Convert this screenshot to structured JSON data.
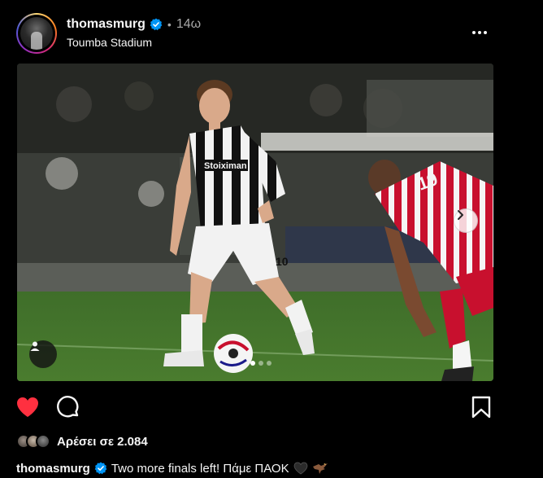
{
  "header": {
    "username": "thomasmurg",
    "separator": "•",
    "time_ago": "14ω",
    "location": "Toumba Stadium",
    "avatar_icon": "profile-avatar"
  },
  "photo": {
    "description_icon": "football-match-photo",
    "jersey_sponsor": "Stoiximan",
    "player_number_white": "10",
    "player_number_red": "19",
    "carousel_dots": 3,
    "carousel_active_index": 0
  },
  "actions": {
    "like_icon": "heart-icon",
    "comment_icon": "comment-icon",
    "save_icon": "bookmark-icon",
    "like_color": "#ff3040"
  },
  "likes": {
    "text": "Αρέσει σε 2.084"
  },
  "caption": {
    "username": "thomasmurg",
    "text": "Two more finals left! Πάμε ΠΑΟΚ",
    "emojis": [
      "black-heart-icon",
      "eagle-icon"
    ]
  },
  "colors": {
    "background": "#000000",
    "text": "#f5f5f5",
    "muted": "#a8a8a8",
    "verified": "#0095f6"
  }
}
